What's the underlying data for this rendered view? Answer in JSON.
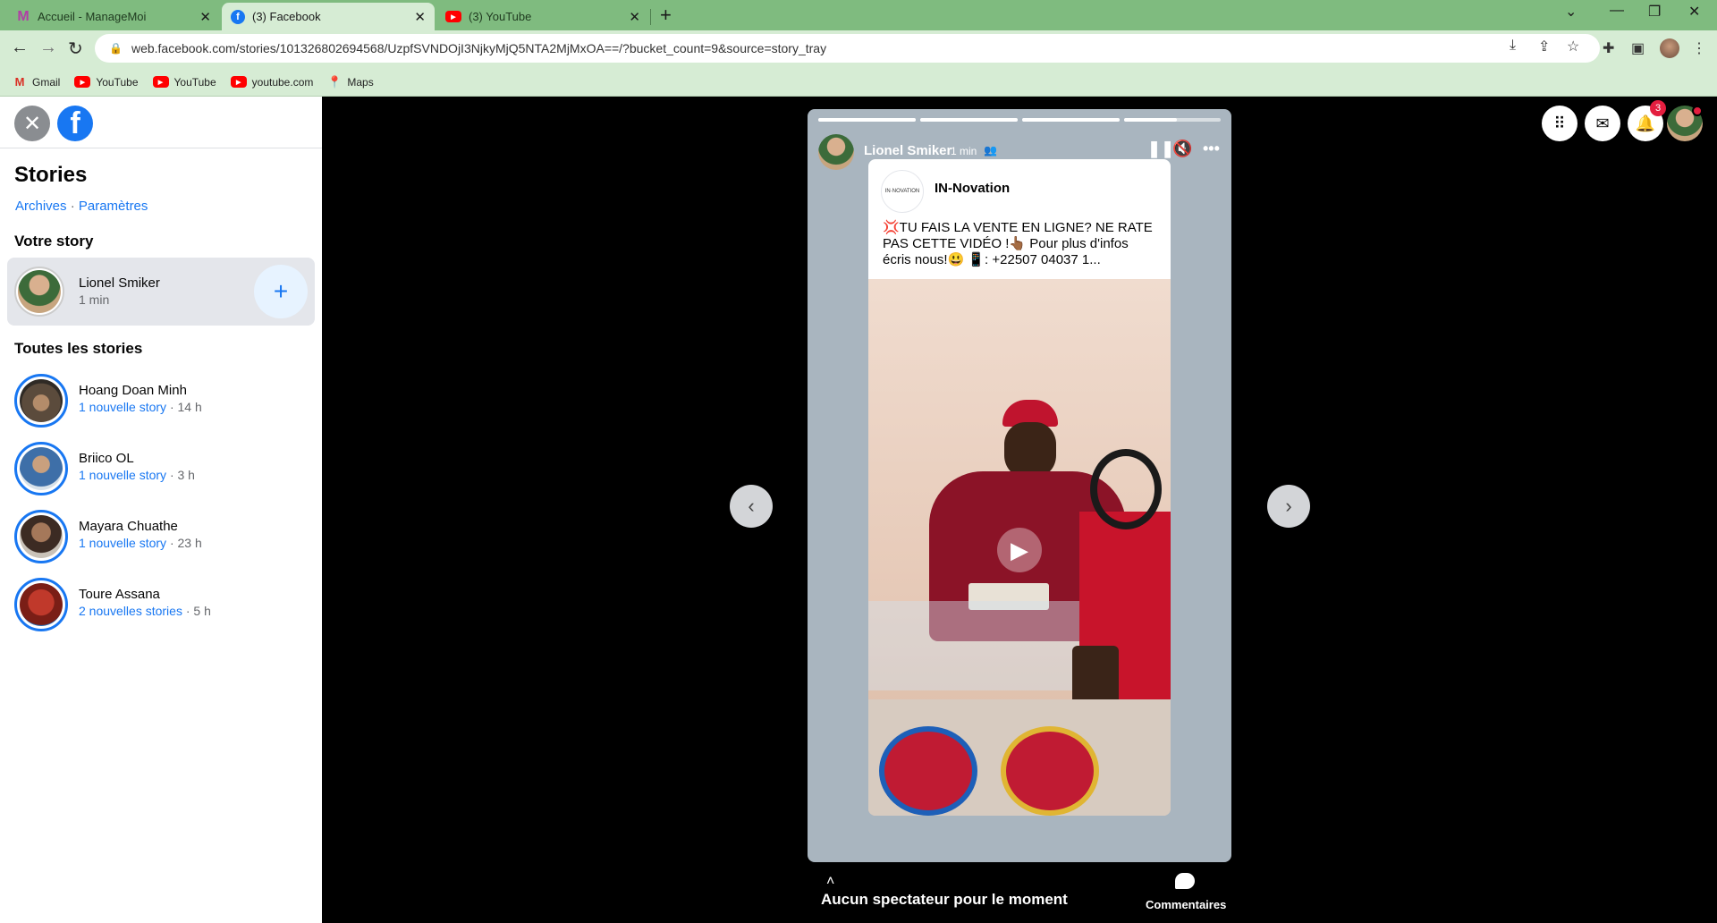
{
  "browser": {
    "tabs": [
      {
        "title": "Accueil - ManageMoi",
        "icon": "managemoi-icon"
      },
      {
        "title": "(3) Facebook",
        "icon": "facebook-icon"
      },
      {
        "title": "(3) YouTube",
        "icon": "youtube-icon"
      }
    ],
    "url": "web.facebook.com/stories/101326802694568/UzpfSVNDOjI3NjkyMjQ5NTA2MjMxOA==/?bucket_count=9&source=story_tray",
    "bookmarks": [
      {
        "label": "Gmail",
        "icon": "gmail-icon"
      },
      {
        "label": "YouTube",
        "icon": "youtube-icon"
      },
      {
        "label": "YouTube",
        "icon": "youtube-icon"
      },
      {
        "label": "youtube.com",
        "icon": "youtube-icon"
      },
      {
        "label": "Maps",
        "icon": "maps-icon"
      }
    ]
  },
  "sidebar": {
    "title": "Stories",
    "archives_link": "Archives",
    "settings_link": "Paramètres",
    "your_story_heading": "Votre story",
    "my_story": {
      "name": "Lionel Smiker",
      "time": "1 min"
    },
    "all_stories_heading": "Toutes les stories",
    "stories": [
      {
        "name": "Hoang Doan Minh",
        "new": "1 nouvelle story",
        "time": " · 14 h"
      },
      {
        "name": "Briico OL",
        "new": "1 nouvelle story",
        "time": " · 3 h"
      },
      {
        "name": "Mayara Chuathe",
        "new": "1 nouvelle story",
        "time": " · 23 h"
      },
      {
        "name": "Toure Assana",
        "new": "2 nouvelles stories",
        "time": " · 5 h"
      }
    ]
  },
  "viewer": {
    "progress": [
      1.0,
      1.0,
      1.0,
      0.55
    ],
    "user": "Lionel Smiker",
    "time": "1 min",
    "post": {
      "logo_text": "IN·NOVATION",
      "page_name": "IN-Novation",
      "text": "💢TU FAIS LA VENTE EN LIGNE? NE RATE PAS CETTE VIDÉO !👆🏾 Pour plus d'infos écris nous!😃 📱: +22507 04037 1..."
    },
    "viewers_text": "Aucun spectateur pour le moment",
    "comments_label": "Commentaires",
    "notification_count": "3"
  },
  "colors": {
    "browser_frame": "#7fbb7f",
    "browser_toolbar": "#d6ecd4",
    "facebook_blue": "#1877f2",
    "story_card_bg": "#a9b5bf",
    "notification_red": "#e41e3f"
  }
}
